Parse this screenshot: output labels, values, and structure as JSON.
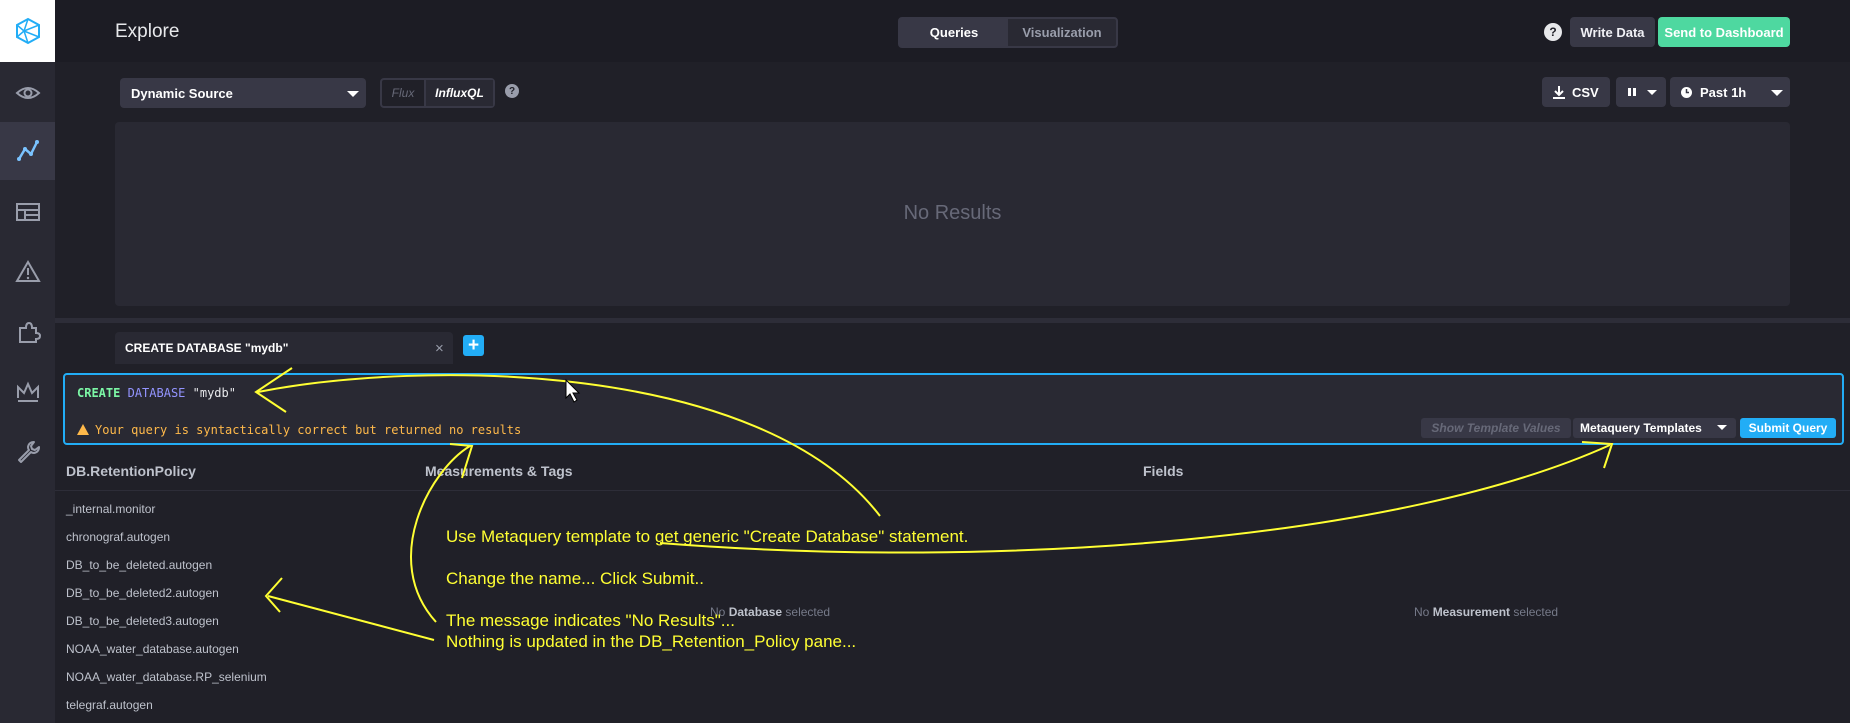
{
  "header": {
    "title": "Explore",
    "tabs": [
      "Queries",
      "Visualization"
    ],
    "help": "?",
    "write_data": "Write Data",
    "send_to_dashboard": "Send to Dashboard"
  },
  "toolbar": {
    "source": "Dynamic Source",
    "languages": [
      "Flux",
      "InfluxQL"
    ],
    "help": "?",
    "csv": "CSV",
    "time_range": "Past 1h"
  },
  "results": {
    "empty": "No Results"
  },
  "query_tab": {
    "label": "CREATE DATABASE \"mydb\"",
    "close": "×",
    "add": "+"
  },
  "editor": {
    "keyword_create": "CREATE",
    "keyword_database": "DATABASE",
    "db_name": "\"mydb\"",
    "status": "Your query is syntactically correct but returned no results",
    "show_template_values": "Show Template Values",
    "metaquery_templates": "Metaquery Templates",
    "submit": "Submit Query"
  },
  "schema": {
    "col_db": "DB.RetentionPolicy",
    "col_measurements": "Measurements & Tags",
    "col_fields": "Fields",
    "databases": [
      "_internal.monitor",
      "chronograf.autogen",
      "DB_to_be_deleted.autogen",
      "DB_to_be_deleted2.autogen",
      "DB_to_be_deleted3.autogen",
      "NOAA_water_database.autogen",
      "NOAA_water_database.RP_selenium",
      "telegraf.autogen"
    ],
    "measurements_empty": {
      "pre": "No",
      "strong": "Database",
      "post": "selected"
    },
    "fields_empty": {
      "pre": "No",
      "strong": "Measurement",
      "post": "selected"
    }
  },
  "annotations": [
    "Use Metaquery template to get generic \"Create Database\" statement.",
    "Change the name...  Click Submit..",
    "The message indicates \"No Results\"...",
    "Nothing is updated in the DB_Retention_Policy pane..."
  ],
  "colors": {
    "accent": "#22adf6",
    "success": "#4ed8a0",
    "warning": "#ffb94a",
    "annotation": "#ffff33"
  }
}
